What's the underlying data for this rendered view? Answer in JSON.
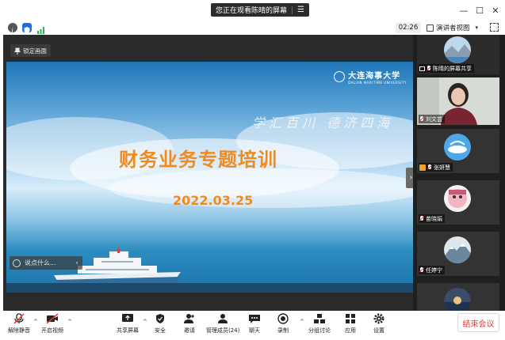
{
  "window": {
    "share_banner": "您正在观看陈晴的屏幕",
    "minimize": "—",
    "maximize": "☐",
    "close": "✕"
  },
  "infobar": {
    "timer": "02:26",
    "view_mode": "演讲者视图"
  },
  "stage": {
    "pin_label": "锁定画面",
    "comment_placeholder": "说点什么...",
    "collapse_arrow": "›"
  },
  "slide": {
    "university_cn": "大连海事大学",
    "university_en": "DALIAN MARITIME UNIVERSITY",
    "calligraphy": "学汇百川 德济四海",
    "title": "财务业务专题培训",
    "date": "2022.03.25"
  },
  "participants": [
    {
      "name": "陈晴的屏幕共享",
      "avatar": "mountain-lake",
      "muted": true,
      "bg": "#2b2b2b"
    },
    {
      "name": "刘文芸",
      "avatar": "camera-video",
      "muted": true,
      "bg": "#cfd3d0"
    },
    {
      "name": "张妍慧",
      "avatar": "blue-sky",
      "muted": true,
      "bg": "#333333"
    },
    {
      "name": "苗晓娟",
      "avatar": "pink-cartoon",
      "muted": true,
      "bg": "#333333"
    },
    {
      "name": "任婷宁",
      "avatar": "snow-mountain",
      "muted": true,
      "bg": "#333333"
    },
    {
      "name": "",
      "avatar": "sea-sunset",
      "muted": false,
      "bg": "#333333"
    }
  ],
  "toolbar": {
    "unmute": "解除静音",
    "start_video": "开启视频",
    "share_screen": "共享屏幕",
    "security": "安全",
    "invite": "邀请",
    "manage_members": "管理成员(24)",
    "chat": "聊天",
    "record": "录制",
    "breakout": "分组讨论",
    "apps": "应用",
    "settings": "设置",
    "end_meeting": "结束会议",
    "caret": "^"
  },
  "colors": {
    "slide_title": "#f28a1e",
    "end_button": "#e03c3c",
    "panel_bg": "#1f1f1f"
  }
}
